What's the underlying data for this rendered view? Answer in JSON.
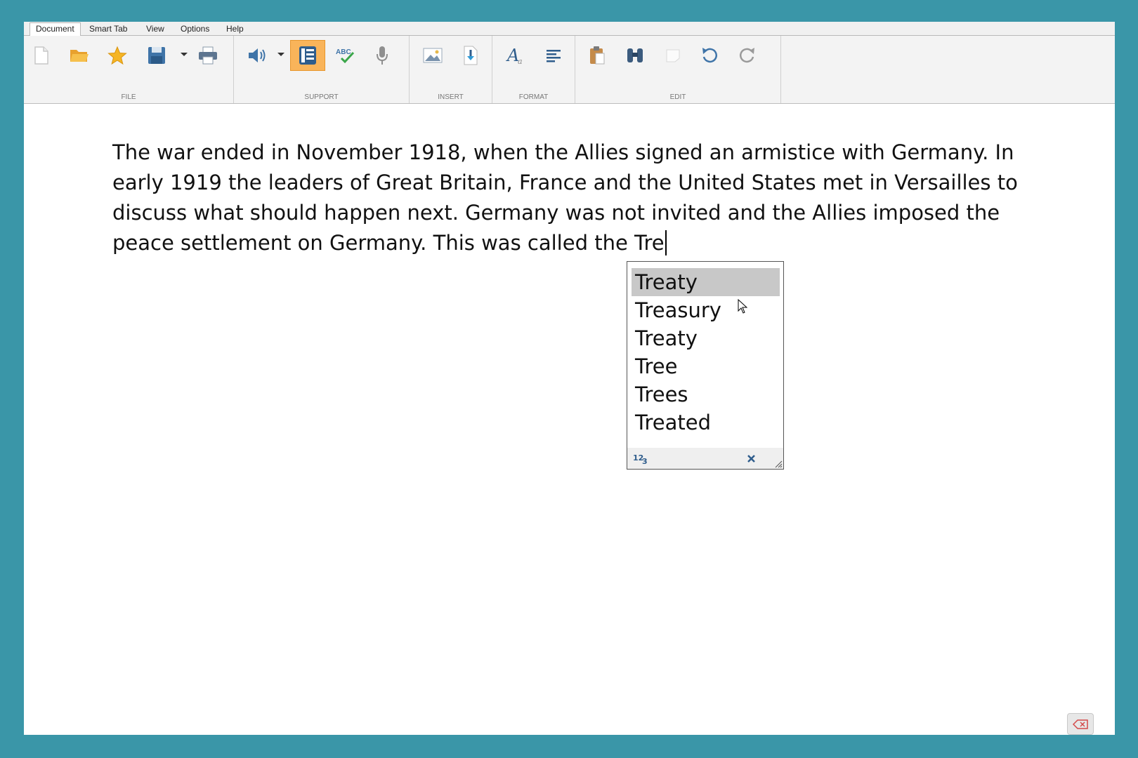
{
  "menu": {
    "tabs": [
      {
        "label": "Document"
      },
      {
        "label": "Smart Tab"
      },
      {
        "label": "View"
      },
      {
        "label": "Options"
      },
      {
        "label": "Help"
      }
    ],
    "active_tab": "Document"
  },
  "ribbon": {
    "groups": [
      {
        "label": "FILE",
        "tools": [
          "new-document-icon",
          "open-folder-icon",
          "favorites-star-icon",
          "save-icon",
          "print-icon"
        ]
      },
      {
        "label": "SUPPORT",
        "tools": [
          "speaker-icon",
          "word-prediction-icon",
          "spellcheck-icon",
          "microphone-icon"
        ]
      },
      {
        "label": "INSERT",
        "tools": [
          "insert-image-icon",
          "insert-file-icon"
        ]
      },
      {
        "label": "FORMAT",
        "tools": [
          "text-style-icon",
          "align-left-icon"
        ]
      },
      {
        "label": "EDIT",
        "tools": [
          "paste-icon",
          "find-binoculars-icon",
          "clear-icon",
          "undo-icon",
          "redo-icon"
        ]
      }
    ],
    "active_tool": "word-prediction-icon",
    "accent_color": "#f9b45a"
  },
  "document": {
    "text": "The war ended in November 1918, when the Allies signed an armistice with Germany. In early 1919 the leaders of Great Britain, France and the United States met in Versailles to discuss what should happen next. Germany was not invited and the Allies imposed the peace settlement on Germany. This was called the Tre"
  },
  "prediction": {
    "suggestions": [
      "Treaty",
      "Treasury",
      "Treaty",
      "Tree",
      "Trees",
      "Treated"
    ],
    "selected_index": 0,
    "footer_icons": [
      "numbers-icon",
      "close-icon",
      "resize-grip-icon"
    ]
  },
  "colors": {
    "desktop_background": "#3a96a8",
    "selection": "#c8c8c8"
  }
}
